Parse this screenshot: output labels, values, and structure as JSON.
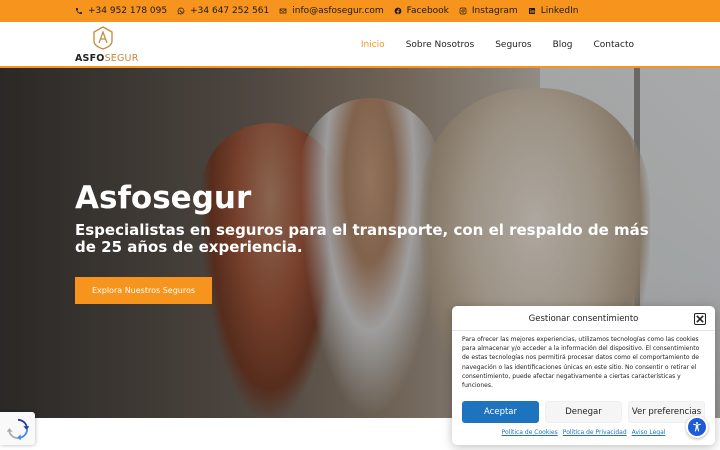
{
  "topbar": {
    "phone1": "+34 952 178 095",
    "phone2": "+34 647 252 561",
    "email": "info@asfosegur.com",
    "facebook": "Facebook",
    "instagram": "Instagram",
    "linkedin": "LinkedIn"
  },
  "brand": {
    "logo_bold": "ASFO",
    "logo_light": "SEGUR"
  },
  "nav": {
    "items": [
      "Inicio",
      "Sobre Nosotros",
      "Seguros",
      "Blog",
      "Contacto"
    ],
    "active_index": 0
  },
  "hero": {
    "title": "Asfosegur",
    "subtitle": "Especialistas en seguros para el transporte, con el respaldo de más de 25 años de experiencia.",
    "cta": "Explora Nuestros Seguros"
  },
  "consent": {
    "title": "Gestionar consentimiento",
    "text": "Para ofrecer las mejores experiencias, utilizamos tecnologías como las cookies para almacenar y/o acceder a la información del dispositivo. El consentimiento de estas tecnologías nos permitirá procesar datos como el comportamiento de navegación o las identificaciones únicas en este sitio. No consentir o retirar el consentimiento, puede afectar negativamente a ciertas características y funciones.",
    "accept": "Aceptar",
    "deny": "Denegar",
    "preferences": "Ver preferencias",
    "links": [
      "Política de Cookies",
      "Política de Privacidad",
      "Aviso Legal"
    ]
  },
  "colors": {
    "accent": "#f7941d",
    "primary_button": "#1e73be",
    "logo_gold": "#c08a3a",
    "a11y_widget": "#1e5bd6"
  },
  "icons": [
    "phone-icon",
    "whatsapp-icon",
    "email-icon",
    "facebook-icon",
    "instagram-icon",
    "linkedin-icon",
    "close-icon",
    "accessibility-icon",
    "recaptcha-icon"
  ]
}
